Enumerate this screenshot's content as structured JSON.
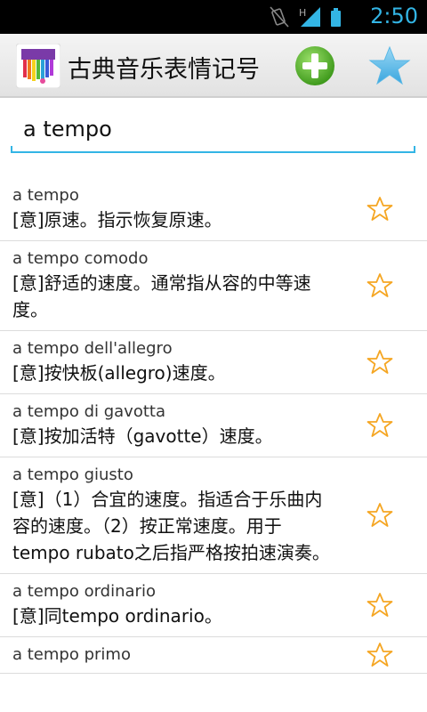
{
  "status_bar": {
    "time": "2:50",
    "network": "H"
  },
  "app": {
    "title": "古典音乐表情记号"
  },
  "search": {
    "value": "a tempo"
  },
  "entries": [
    {
      "term": "a tempo",
      "definition": "[意]原速。指示恢复原速。"
    },
    {
      "term": "a tempo comodo",
      "definition": "[意]舒适的速度。通常指从容的中等速度。"
    },
    {
      "term": "a tempo dell'allegro",
      "definition": "[意]按快板(allegro)速度。"
    },
    {
      "term": "a tempo di gavotta",
      "definition": "[意]按加活特（gavotte）速度。"
    },
    {
      "term": "a tempo giusto",
      "definition": "[意]（1）合宜的速度。指适合于乐曲内容的速度。（2）按正常速度。用于tempo rubato之后指严格按拍速演奏。"
    },
    {
      "term": "a tempo ordinario",
      "definition": "[意]同tempo ordinario。"
    },
    {
      "term": "a tempo primo",
      "definition": ""
    }
  ],
  "colors": {
    "accent": "#33b5e5",
    "star": "#f5a623",
    "add": "#5cb82a"
  }
}
